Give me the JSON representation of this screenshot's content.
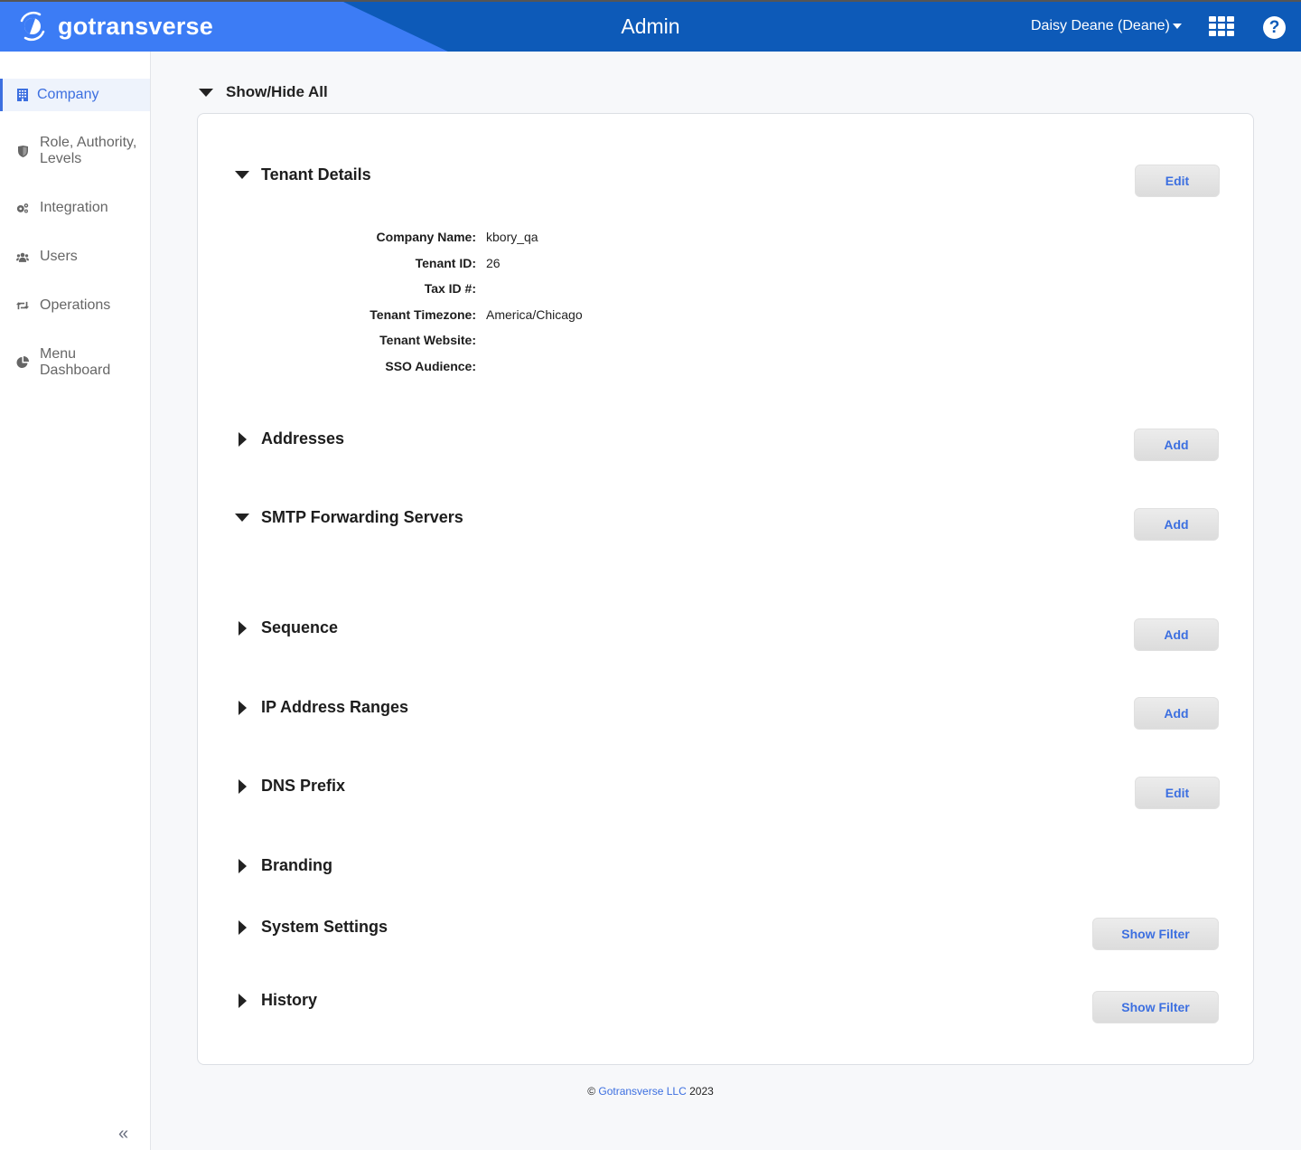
{
  "header": {
    "brand": "gotransverse",
    "title": "Admin",
    "user_menu": "Daisy Deane (Deane)",
    "apps_icon": "grid-icon",
    "help_icon": "?"
  },
  "sidebar": {
    "items": [
      {
        "label": "Company",
        "icon": "building-icon",
        "active": true
      },
      {
        "label": "Role, Authority, Levels",
        "icon": "shield-icon"
      },
      {
        "label": "Integration",
        "icon": "gears-icon"
      },
      {
        "label": "Users",
        "icon": "users-icon"
      },
      {
        "label": "Operations",
        "icon": "retweet-icon"
      },
      {
        "label": "Menu Dashboard",
        "icon": "pie-chart-icon"
      }
    ],
    "collapse": "«"
  },
  "main": {
    "show_hide_all": "Show/Hide All",
    "sections": [
      {
        "title": "Tenant Details",
        "expanded": true,
        "button": "Edit"
      },
      {
        "title": "Addresses",
        "expanded": false,
        "button": "Add"
      },
      {
        "title": "SMTP Forwarding Servers",
        "expanded": true,
        "button": "Add"
      },
      {
        "title": "Sequence",
        "expanded": false,
        "button": "Add"
      },
      {
        "title": "IP Address Ranges",
        "expanded": false,
        "button": "Add"
      },
      {
        "title": "DNS Prefix",
        "expanded": false,
        "button": "Edit"
      },
      {
        "title": "Branding",
        "expanded": false
      },
      {
        "title": "System Settings",
        "expanded": false,
        "button": "Show Filter"
      },
      {
        "title": "History",
        "expanded": false,
        "button": "Show Filter"
      }
    ],
    "tenant_details": [
      {
        "label": "Company Name:",
        "value": "kbory_qa"
      },
      {
        "label": "Tenant ID:",
        "value": "26"
      },
      {
        "label": "Tax ID #:",
        "value": ""
      },
      {
        "label": "Tenant Timezone:",
        "value": "America/Chicago"
      },
      {
        "label": "Tenant Website:",
        "value": ""
      },
      {
        "label": "SSO Audience:",
        "value": ""
      }
    ]
  },
  "footer": {
    "copyright": "©",
    "company_link": "Gotransverse LLC",
    "year": "2023"
  }
}
